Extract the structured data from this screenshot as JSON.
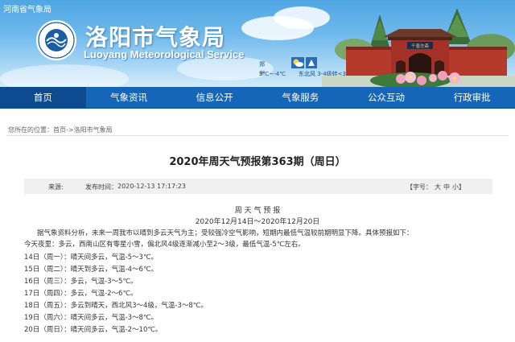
{
  "header": {
    "top_link": "河南省气象局",
    "logo_text_cn": "中国气象",
    "logo_text_en": "CHINA METEOROLOGICAL",
    "title": "洛阳市气象局",
    "subtitle": "Luoyang Meteorological Service",
    "weather": {
      "city": "郑州",
      "temp": "3℃~-4℃",
      "wind": "东北风 3-4级转<3级",
      "icons": [
        "sunny-cloudy-icon",
        "wind-icon"
      ]
    },
    "gate_sign": "千唐志斋"
  },
  "nav": {
    "items": [
      {
        "label": "首页",
        "active": true
      },
      {
        "label": "气象资讯"
      },
      {
        "label": "信息公开"
      },
      {
        "label": "气象服务"
      },
      {
        "label": "公众互动"
      },
      {
        "label": "行政审批"
      }
    ]
  },
  "breadcrumb": {
    "prefix": "您所在的位置：",
    "home": "首页",
    "sep": "->",
    "current": "洛阳市气象局"
  },
  "article": {
    "title": "2020年周天气预报第363期（周日）",
    "source_label": "来源:",
    "publish_label": "发布时间：",
    "publish_time": "2020-12-13 17:17:23",
    "font_label": "【字号：",
    "font_sizes": [
      "大",
      "中",
      "小"
    ],
    "font_close": "】",
    "heading": "周 天 气 预 报",
    "date_range": "2020年12月14日～2020年12月20日",
    "intro": "据气象资料分析，未来一周我市以晴到多云天气为主；受较强冷空气影响，短期内最低气温较前期明显下降。具体预报如下：",
    "tonight": "今天夜里：多云，西南山区有零星小雪，偏北风4级逐渐减小至2～3级，最低气温-5℃左右。",
    "days": [
      "14日（周一）：晴天间多云，气温-5～3℃。",
      "15日（周二）：晴天到多云，气温-4～6℃。",
      "16日（周三）：多云，气温-3～5℃。",
      "17日（周四）：多云，气温-2～6℃。",
      "18日（周五）：多云到晴天，西北风3～4级，气温-3～8℃。",
      "19日（周六）：晴天间多云，气温-3～8℃。",
      "20日（周日）：晴天间多云，气温-2～10℃。"
    ]
  },
  "colors": {
    "nav_bg": "#1565b8",
    "nav_active": "#0d4a8f",
    "sky_top": "#4fa6e3",
    "meta_bar": "#f0f0f0"
  }
}
